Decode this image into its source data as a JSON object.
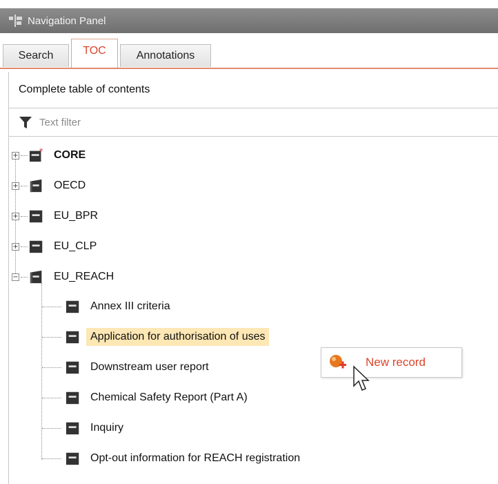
{
  "window": {
    "title": "Navigation Panel"
  },
  "tabs": [
    {
      "label": "Search",
      "active": false
    },
    {
      "label": "TOC",
      "active": true
    },
    {
      "label": "Annotations",
      "active": false
    }
  ],
  "toc": {
    "heading": "Complete table of contents",
    "filter_placeholder": "Text filter"
  },
  "tree": {
    "roots": [
      {
        "label": "CORE",
        "expanded": false,
        "bold": true,
        "icon": "book-star-icon"
      },
      {
        "label": "OECD",
        "expanded": false,
        "bold": false,
        "icon": "open-book-icon"
      },
      {
        "label": "EU_BPR",
        "expanded": false,
        "bold": false,
        "icon": "book-icon"
      },
      {
        "label": "EU_CLP",
        "expanded": false,
        "bold": false,
        "icon": "book-icon"
      },
      {
        "label": "EU_REACH",
        "expanded": true,
        "bold": false,
        "icon": "open-book-icon"
      }
    ],
    "reach_children": [
      {
        "label": "Annex III criteria",
        "selected": false
      },
      {
        "label": "Application for authorisation of uses",
        "selected": true
      },
      {
        "label": "Downstream user report",
        "selected": false
      },
      {
        "label": "Chemical Safety Report (Part A)",
        "selected": false
      },
      {
        "label": "Inquiry",
        "selected": false
      },
      {
        "label": "Opt-out information for REACH registration",
        "selected": false
      }
    ]
  },
  "context_menu": {
    "new_record_label": "New record",
    "icon": "new-record-icon"
  },
  "colors": {
    "accent": "#d9452b",
    "selection": "#fde7b4",
    "titlebar": "#7d7d7d"
  }
}
